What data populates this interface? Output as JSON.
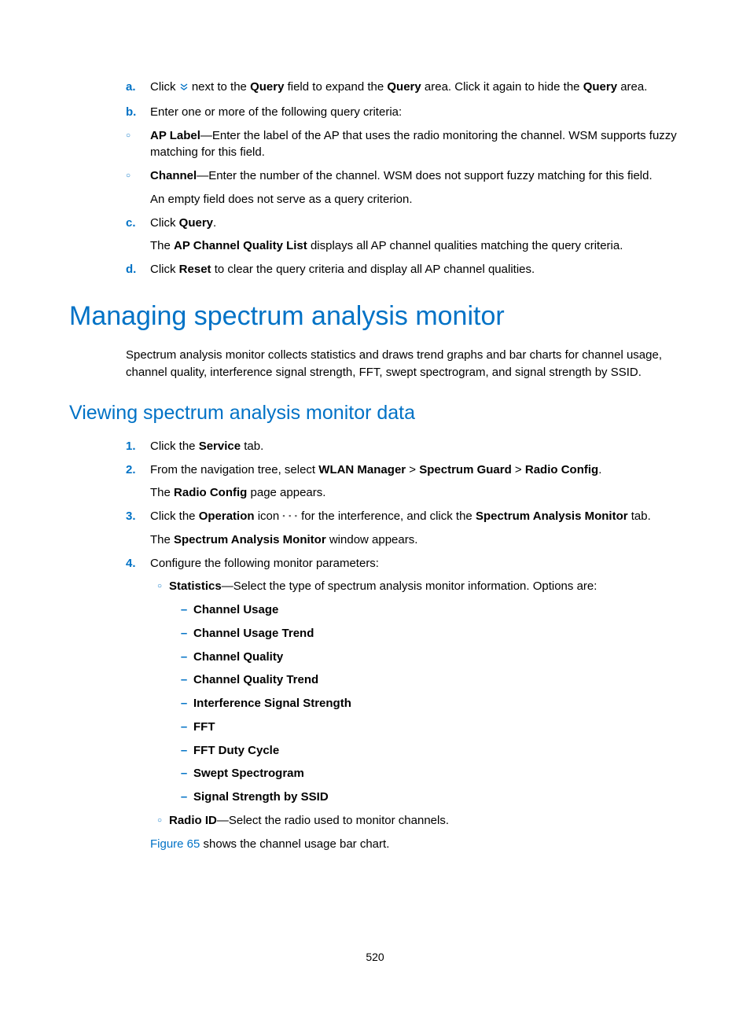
{
  "list_a": {
    "marker": "a.",
    "t1": "Click ",
    "t2": " next to the ",
    "q1": "Query",
    "t3": " field to expand the ",
    "q2": "Query",
    "t4": " area. Click it again to hide the ",
    "q3": "Query",
    "t5": " area."
  },
  "list_b": {
    "marker": "b.",
    "text": "Enter one or more of the following query criteria:"
  },
  "sub_ap": {
    "label": "AP Label",
    "text": "—Enter the label of the AP that uses the radio monitoring the channel. WSM supports fuzzy matching for this field."
  },
  "sub_ch": {
    "label": "Channel",
    "text": "—Enter the number of the channel. WSM does not support fuzzy matching for this field.",
    "note": "An empty field does not serve as a query criterion."
  },
  "list_c": {
    "marker": "c.",
    "t1": "Click ",
    "q": "Query",
    "t2": ".",
    "sub_t1": "The ",
    "sub_b": "AP Channel Quality List",
    "sub_t2": " displays all AP channel qualities matching the query criteria."
  },
  "list_d": {
    "marker": "d.",
    "t1": "Click ",
    "r": "Reset",
    "t2": " to clear the query criteria and display all AP channel qualities."
  },
  "h1": "Managing spectrum analysis monitor",
  "h1_para": "Spectrum analysis monitor collects statistics and draws trend graphs and bar charts for channel usage, channel quality, interference signal strength, FFT, swept spectrogram, and signal strength by SSID.",
  "h2": "Viewing spectrum analysis monitor data",
  "step1": {
    "marker": "1.",
    "t1": "Click the ",
    "b": "Service",
    "t2": " tab."
  },
  "step2": {
    "marker": "2.",
    "t1": "From the navigation tree, select ",
    "b1": "WLAN Manager",
    "gt1": " > ",
    "b2": "Spectrum Guard",
    "gt2": " > ",
    "b3": "Radio Config",
    "t2": ".",
    "sub_t1": "The ",
    "sub_b": "Radio Config",
    "sub_t2": " page appears."
  },
  "step3": {
    "marker": "3.",
    "t1": "Click the ",
    "b1": "Operation",
    "t2": " icon ",
    "t3": " for the interference, and click the ",
    "b2": "Spectrum Analysis Monitor",
    "t4": " tab.",
    "sub_t1": "The ",
    "sub_b": "Spectrum Analysis Monitor",
    "sub_t2": " window appears."
  },
  "step4": {
    "marker": "4.",
    "text": "Configure the following monitor parameters:"
  },
  "p_stat": {
    "label": "Statistics",
    "text": "—Select the type of spectrum analysis monitor information. Options are:"
  },
  "opts": {
    "cu": "Channel Usage",
    "cut": "Channel Usage Trend",
    "cq": "Channel Quality",
    "cqt": "Channel Quality Trend",
    "iss": "Interference Signal Strength",
    "fft": "FFT",
    "fftd": "FFT Duty Cycle",
    "ss": "Swept Spectrogram",
    "ssid": "Signal Strength by SSID"
  },
  "p_radio": {
    "label": "Radio ID",
    "text": "—Select the radio used to monitor channels."
  },
  "fig": {
    "link": "Figure 65",
    "text": " shows the channel usage bar chart."
  },
  "dash": "–",
  "circle": "○",
  "dots": "▪ ▪ ▪",
  "page": "520"
}
